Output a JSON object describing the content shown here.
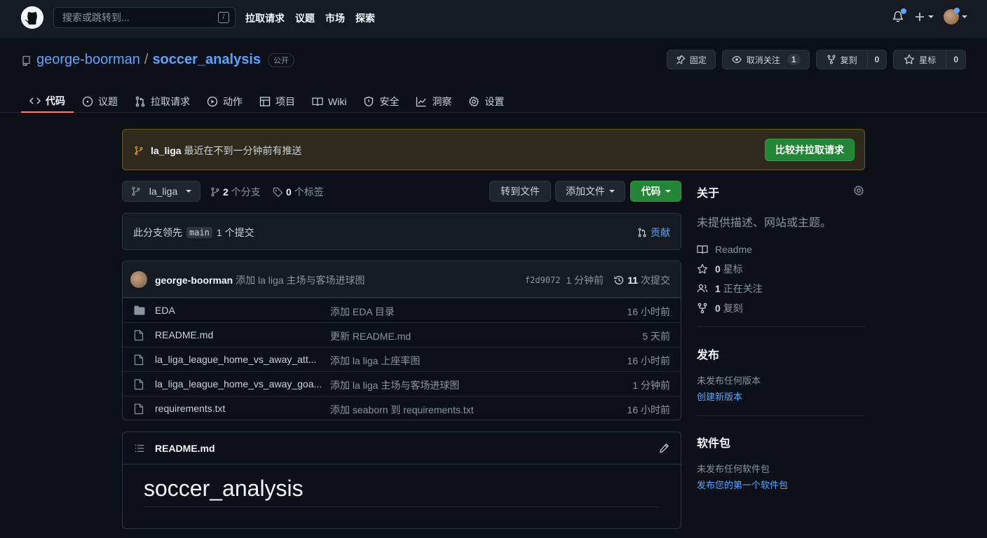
{
  "header": {
    "search_placeholder": "搜索或跳转到...",
    "search_key": "/",
    "nav": [
      "拉取请求",
      "议题",
      "市场",
      "探索"
    ]
  },
  "repo": {
    "owner": "george-boorman",
    "slash": "/",
    "name": "soccer_analysis",
    "visibility": "公开",
    "buttons": {
      "pin": "固定",
      "unwatch": "取消关注",
      "unwatch_count": "1",
      "fork": "复刻",
      "fork_count": "0",
      "star": "星标",
      "star_count": "0"
    },
    "tabs": [
      "代码",
      "议题",
      "拉取请求",
      "动作",
      "项目",
      "Wiki",
      "安全",
      "洞察",
      "设置"
    ]
  },
  "banner": {
    "branch": "la_liga",
    "message": "最近在不到一分钟前有推送",
    "button": "比较并拉取请求"
  },
  "toolbar": {
    "branch": "la_liga",
    "branches_count": "2",
    "branches_label": "个分支",
    "tags_count": "0",
    "tags_label": "个标签",
    "goto_file": "转到文件",
    "add_file": "添加文件",
    "code": "代码"
  },
  "ahead": {
    "prefix": "此分支领先",
    "base": "main",
    "suffix": "1 个提交",
    "contribute": "贡献"
  },
  "latest_commit": {
    "author": "george-boorman",
    "message": "添加 la liga 主场与客场进球图",
    "sha": "f2d9072",
    "time": "1 分钟前",
    "commits_count": "11",
    "commits_label": "次提交"
  },
  "files": [
    {
      "type": "folder",
      "name": "EDA",
      "message": "添加 EDA 目录",
      "time": "16 小时前"
    },
    {
      "type": "file",
      "name": "README.md",
      "message": "更新 README.md",
      "time": "5 天前"
    },
    {
      "type": "file",
      "name": "la_liga_league_home_vs_away_att...",
      "message": "添加 la liga 上座率图",
      "time": "16 小时前"
    },
    {
      "type": "file",
      "name": "la_liga_league_home_vs_away_goa...",
      "message": "添加 la liga 主场与客场进球图",
      "time": "1 分钟前"
    },
    {
      "type": "file",
      "name": "requirements.txt",
      "message": "添加 seaborn 到 requirements.txt",
      "time": "16 小时前"
    }
  ],
  "readme": {
    "filename": "README.md",
    "heading": "soccer_analysis"
  },
  "sidebar": {
    "about_title": "关于",
    "about_desc": "未提供描述、网站或主题。",
    "readme": "Readme",
    "stars_count": "0",
    "stars_label": "星标",
    "watching_count": "1",
    "watching_label": "正在关注",
    "forks_count": "0",
    "forks_label": "复刻",
    "releases_title": "发布",
    "releases_none": "未发布任何版本",
    "releases_link": "创建新版本",
    "packages_title": "软件包",
    "packages_none": "未发布任何软件包",
    "packages_link": "发布您的第一个软件包"
  }
}
